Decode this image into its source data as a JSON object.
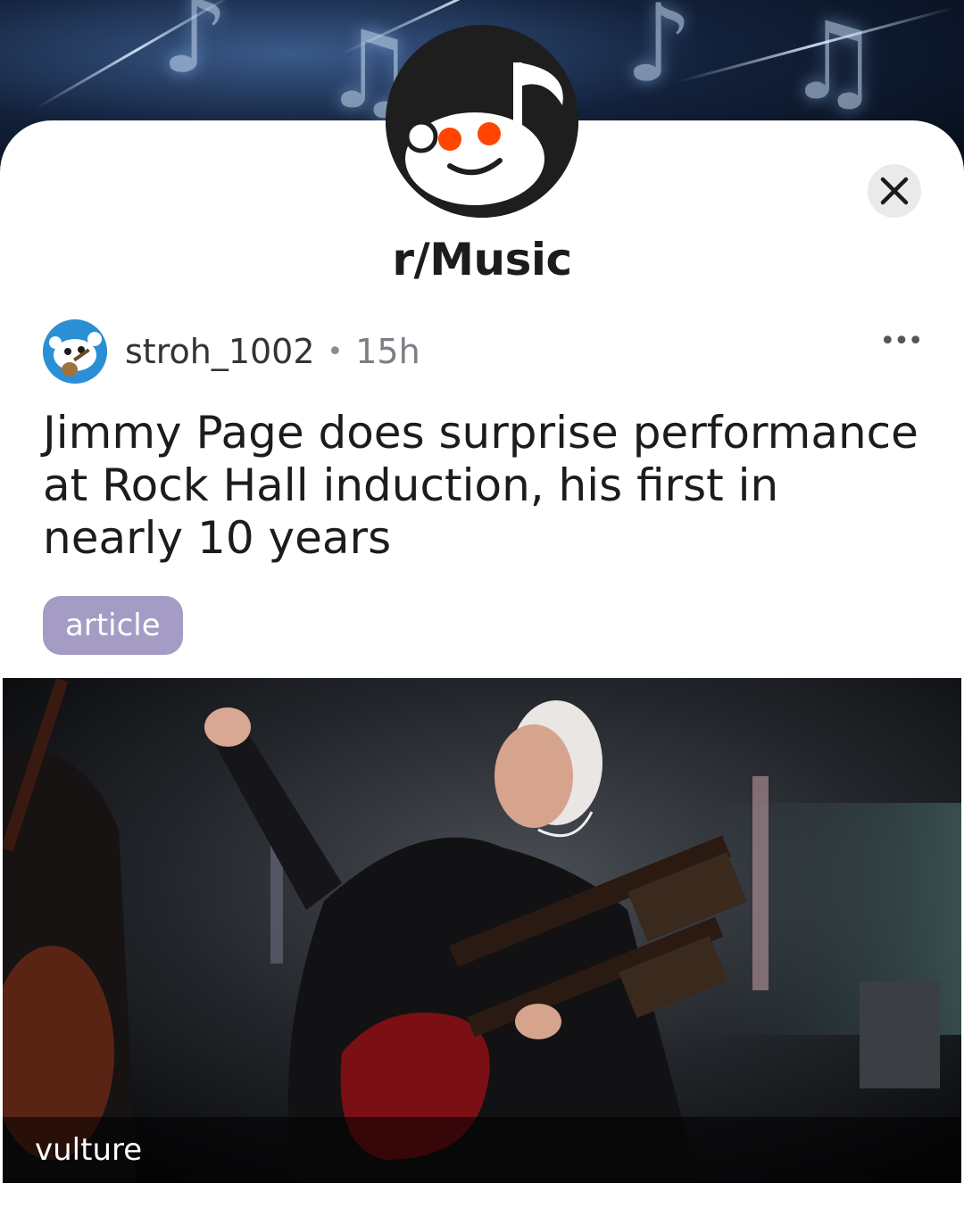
{
  "subreddit": {
    "name": "r/Music",
    "avatar_icon": "reddit-music-snoo-icon",
    "banner_icon": "music-notes-banner"
  },
  "controls": {
    "close_icon": "close-icon",
    "more_icon": "more-options-icon",
    "more_label": "•••"
  },
  "post": {
    "username": "stroh_1002",
    "separator": "•",
    "age": "15h",
    "title": "Jimmy Page does surprise performance at Rock Hall induction, his first in nearly 10 years",
    "flair": "article",
    "link_source": "vulture"
  },
  "colors": {
    "flair_bg": "#a59cc6",
    "avatar_orange": "#ff4500",
    "close_bg": "#e9eaec"
  }
}
